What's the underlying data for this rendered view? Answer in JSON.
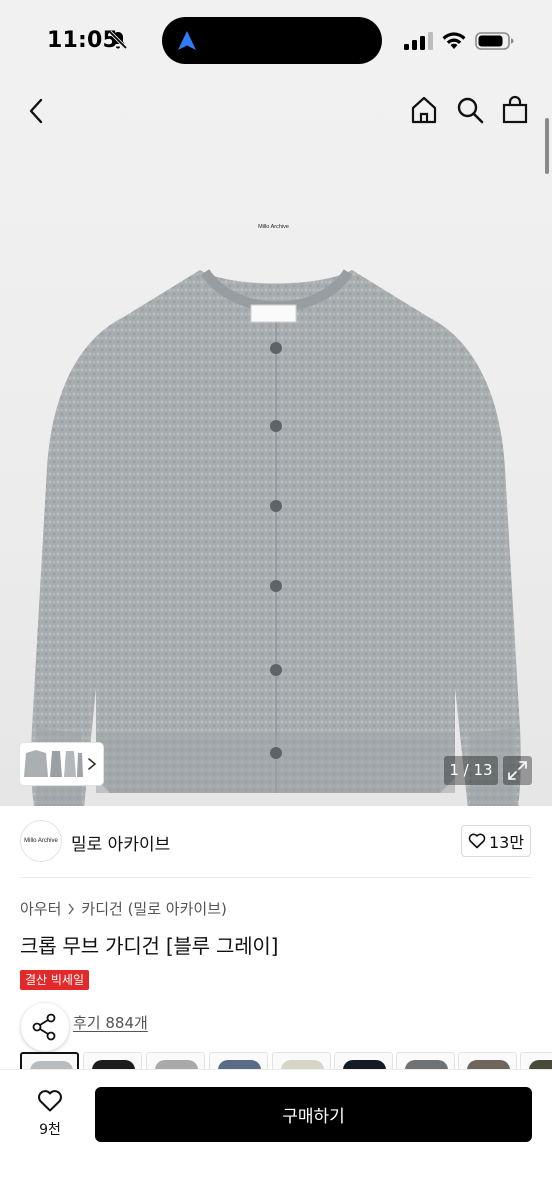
{
  "status_bar": {
    "time": "11:05",
    "icons": [
      "bell-off-icon",
      "location-arrow-icon",
      "signal-icon",
      "wifi-icon",
      "battery-icon"
    ],
    "location_color": "#2f7cf6"
  },
  "header": {
    "icons": [
      "back-icon",
      "home-icon",
      "search-icon",
      "shopping-bag-icon"
    ]
  },
  "gallery": {
    "label_tag": "Millo Archive",
    "counter": "1 / 13",
    "expand_icon": "expand-icon",
    "more_icon": "chevron-right-icon"
  },
  "brand": {
    "logo_text": "Millo Archive",
    "name": "밀로 아카이브",
    "like_count": "13만"
  },
  "breadcrumb": {
    "items": [
      "아우터",
      "카디건 (밀로 아카이브)"
    ]
  },
  "product": {
    "title": "크롭 무브 가디건 [블루 그레이]",
    "badge": "결산 빅세일",
    "badge_color": "#e22a2a",
    "reviews": "후기 884개"
  },
  "swatches": {
    "colors": [
      "#b6bcc0",
      "#1d1d1d",
      "#a9a9a9",
      "#5a6c85",
      "#d9d4c8",
      "#151b24",
      "#6f7275",
      "#6e665c",
      "#4a4a3a"
    ]
  },
  "bottom": {
    "wish_count": "9천",
    "buy_label": "구매하기"
  },
  "colors": {
    "knit": "#a8aeb0",
    "button_bg": "#000000"
  }
}
